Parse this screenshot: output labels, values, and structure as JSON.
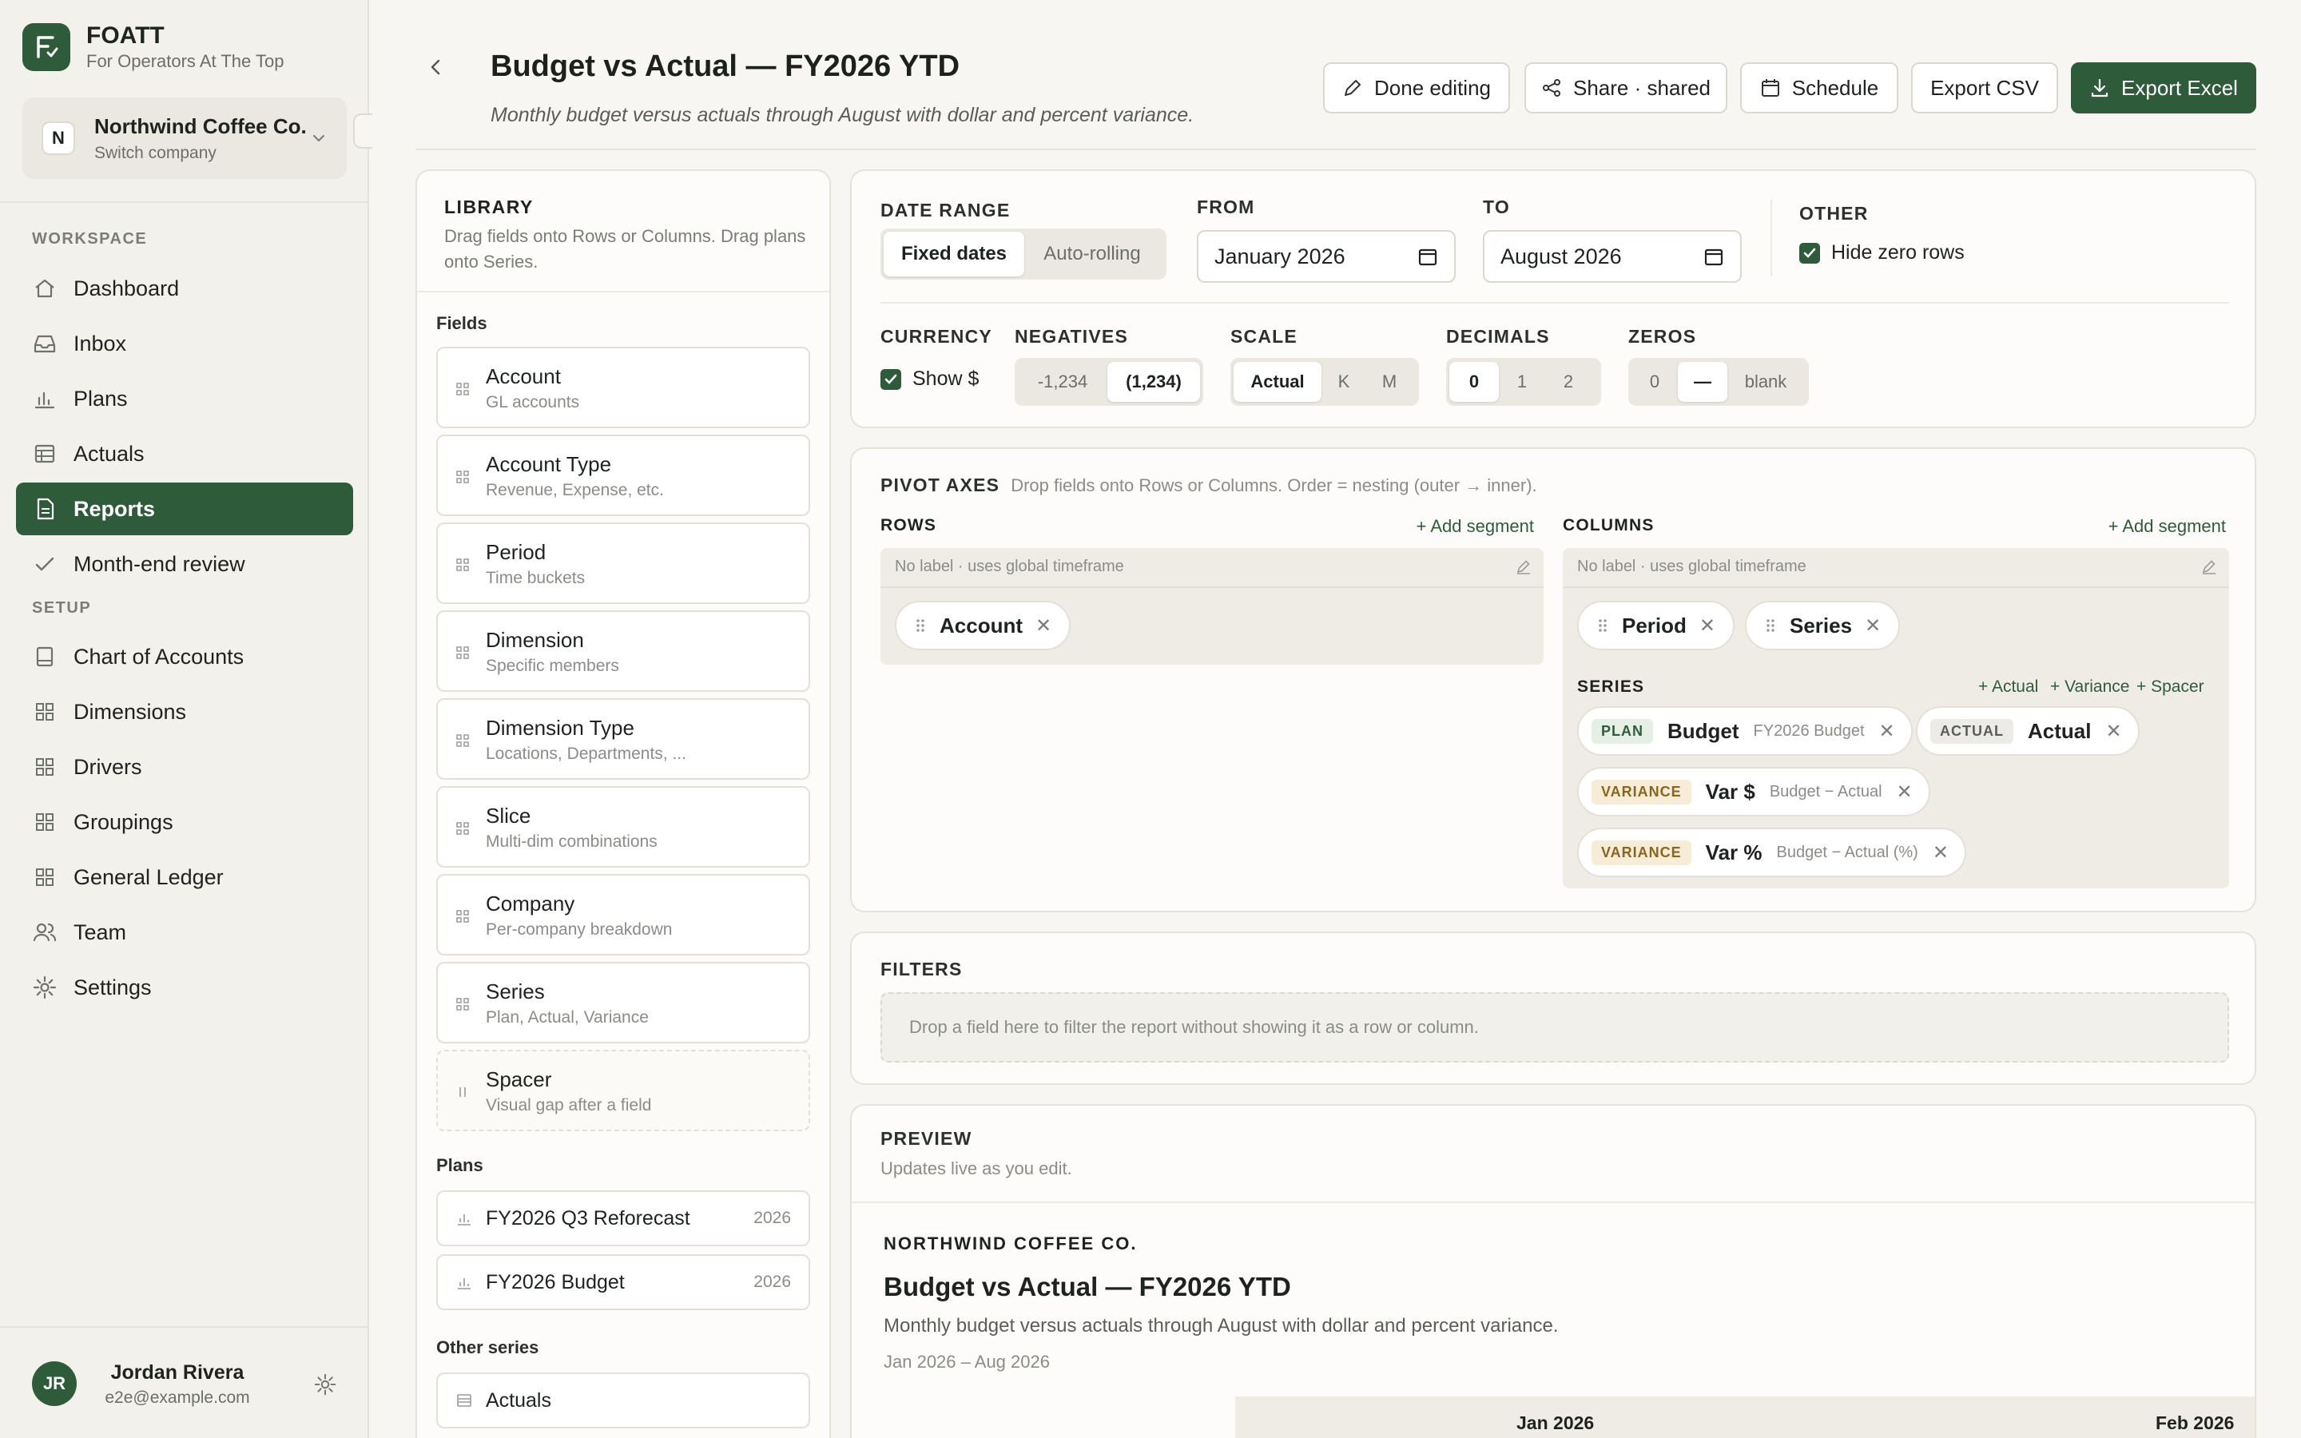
{
  "brand": {
    "name": "FOATT",
    "tagline": "For Operators At The Top",
    "logo_letter": "F"
  },
  "company": {
    "initial": "N",
    "name": "Northwind Coffee Co.",
    "sub": "Switch company"
  },
  "sidebar": {
    "workspace_label": "WORKSPACE",
    "workspace_items": [
      {
        "label": "Dashboard",
        "icon": "home-icon"
      },
      {
        "label": "Inbox",
        "icon": "inbox-icon"
      },
      {
        "label": "Plans",
        "icon": "bar-chart-icon"
      },
      {
        "label": "Actuals",
        "icon": "table-icon"
      },
      {
        "label": "Reports",
        "icon": "report-icon",
        "active": true
      },
      {
        "label": "Month-end review",
        "icon": "check-icon"
      }
    ],
    "setup_label": "SETUP",
    "setup_items": [
      {
        "label": "Chart of Accounts",
        "icon": "book-icon"
      },
      {
        "label": "Dimensions",
        "icon": "grid-icon"
      },
      {
        "label": "Drivers",
        "icon": "grid-icon"
      },
      {
        "label": "Groupings",
        "icon": "grid-icon"
      },
      {
        "label": "General Ledger",
        "icon": "grid-icon"
      },
      {
        "label": "Team",
        "icon": "users-icon"
      },
      {
        "label": "Settings",
        "icon": "gear-icon"
      }
    ]
  },
  "user": {
    "initials": "JR",
    "name": "Jordan Rivera",
    "email": "e2e@example.com"
  },
  "header": {
    "title": "Budget vs Actual — FY2026 YTD",
    "subtitle": "Monthly budget versus actuals through August with dollar and percent variance.",
    "buttons": {
      "done": "Done editing",
      "share": "Share · shared",
      "schedule": "Schedule",
      "export_csv": "Export CSV",
      "export_excel": "Export Excel"
    }
  },
  "library": {
    "title": "LIBRARY",
    "desc": "Drag fields onto Rows or Columns. Drag plans onto Series.",
    "fields_label": "Fields",
    "fields": [
      {
        "name": "Account",
        "desc": "GL accounts"
      },
      {
        "name": "Account Type",
        "desc": "Revenue, Expense, etc."
      },
      {
        "name": "Period",
        "desc": "Time buckets"
      },
      {
        "name": "Dimension",
        "desc": "Specific members"
      },
      {
        "name": "Dimension Type",
        "desc": "Locations, Departments, ..."
      },
      {
        "name": "Slice",
        "desc": "Multi-dim combinations"
      },
      {
        "name": "Company",
        "desc": "Per-company breakdown"
      },
      {
        "name": "Series",
        "desc": "Plan, Actual, Variance"
      },
      {
        "name": "Spacer",
        "desc": "Visual gap after a field"
      }
    ],
    "plans_label": "Plans",
    "plans": [
      {
        "name": "FY2026 Q3 Reforecast",
        "year": "2026"
      },
      {
        "name": "FY2026 Budget",
        "year": "2026"
      }
    ],
    "other_label": "Other series",
    "other": [
      {
        "name": "Actuals"
      }
    ]
  },
  "settings": {
    "date_range": {
      "label": "DATE RANGE",
      "options": [
        "Fixed dates",
        "Auto-rolling"
      ],
      "selected": "Fixed dates"
    },
    "from": {
      "label": "FROM",
      "value": "January  2026"
    },
    "to": {
      "label": "TO",
      "value": "August  2026"
    },
    "other": {
      "label": "OTHER",
      "hide_zero_rows": "Hide zero rows",
      "hide_zero_checked": true
    },
    "currency": {
      "label": "CURRENCY",
      "show_dollar": "Show $",
      "checked": true
    },
    "negatives": {
      "label": "NEGATIVES",
      "options": [
        "-1,234",
        "(1,234)"
      ],
      "selected": "(1,234)"
    },
    "scale": {
      "label": "SCALE",
      "options": [
        "Actual",
        "K",
        "M"
      ],
      "selected": "Actual"
    },
    "decimals": {
      "label": "DECIMALS",
      "options": [
        "0",
        "1",
        "2"
      ],
      "selected": "0"
    },
    "zeros": {
      "label": "ZEROS",
      "options": [
        "0",
        "—",
        "blank"
      ],
      "selected": "—"
    }
  },
  "pivot": {
    "title": "PIVOT AXES",
    "hint": "Drop fields onto Rows or Columns. Order = nesting (outer → inner).",
    "rows": {
      "label": "ROWS",
      "add": "+ Add segment",
      "zone_label": "No label · uses global timeframe",
      "chips": [
        "Account"
      ]
    },
    "columns": {
      "label": "COLUMNS",
      "add": "+ Add segment",
      "zone_label": "No label · uses global timeframe",
      "chips": [
        "Period",
        "Series"
      ]
    },
    "series": {
      "label": "SERIES",
      "add_actual": "+ Actual",
      "add_variance": "+ Variance",
      "add_spacer": "+ Spacer",
      "items": [
        {
          "badge": "PLAN",
          "name": "Budget",
          "desc": "FY2026 Budget"
        },
        {
          "badge": "ACTUAL",
          "name": "Actual",
          "desc": ""
        },
        {
          "badge": "VARIANCE",
          "name": "Var $",
          "desc": "Budget − Actual"
        },
        {
          "badge": "VARIANCE",
          "name": "Var %",
          "desc": "Budget − Actual (%)"
        }
      ]
    }
  },
  "filters": {
    "title": "FILTERS",
    "placeholder": "Drop a field here to filter the report without showing it as a row or column."
  },
  "preview": {
    "title": "PREVIEW",
    "sub": "Updates live as you edit.",
    "company": "NORTHWIND COFFEE CO.",
    "report_title": "Budget vs Actual — FY2026 YTD",
    "report_desc": "Monthly budget versus actuals through August with dollar and percent variance.",
    "range": "Jan 2026 – Aug 2026",
    "columns": [
      "Jan 2026",
      "Feb 2026"
    ]
  },
  "colors": {
    "accent": "#2e5c3a",
    "background": "#f7f6f2",
    "panel": "#fdfcfa"
  }
}
